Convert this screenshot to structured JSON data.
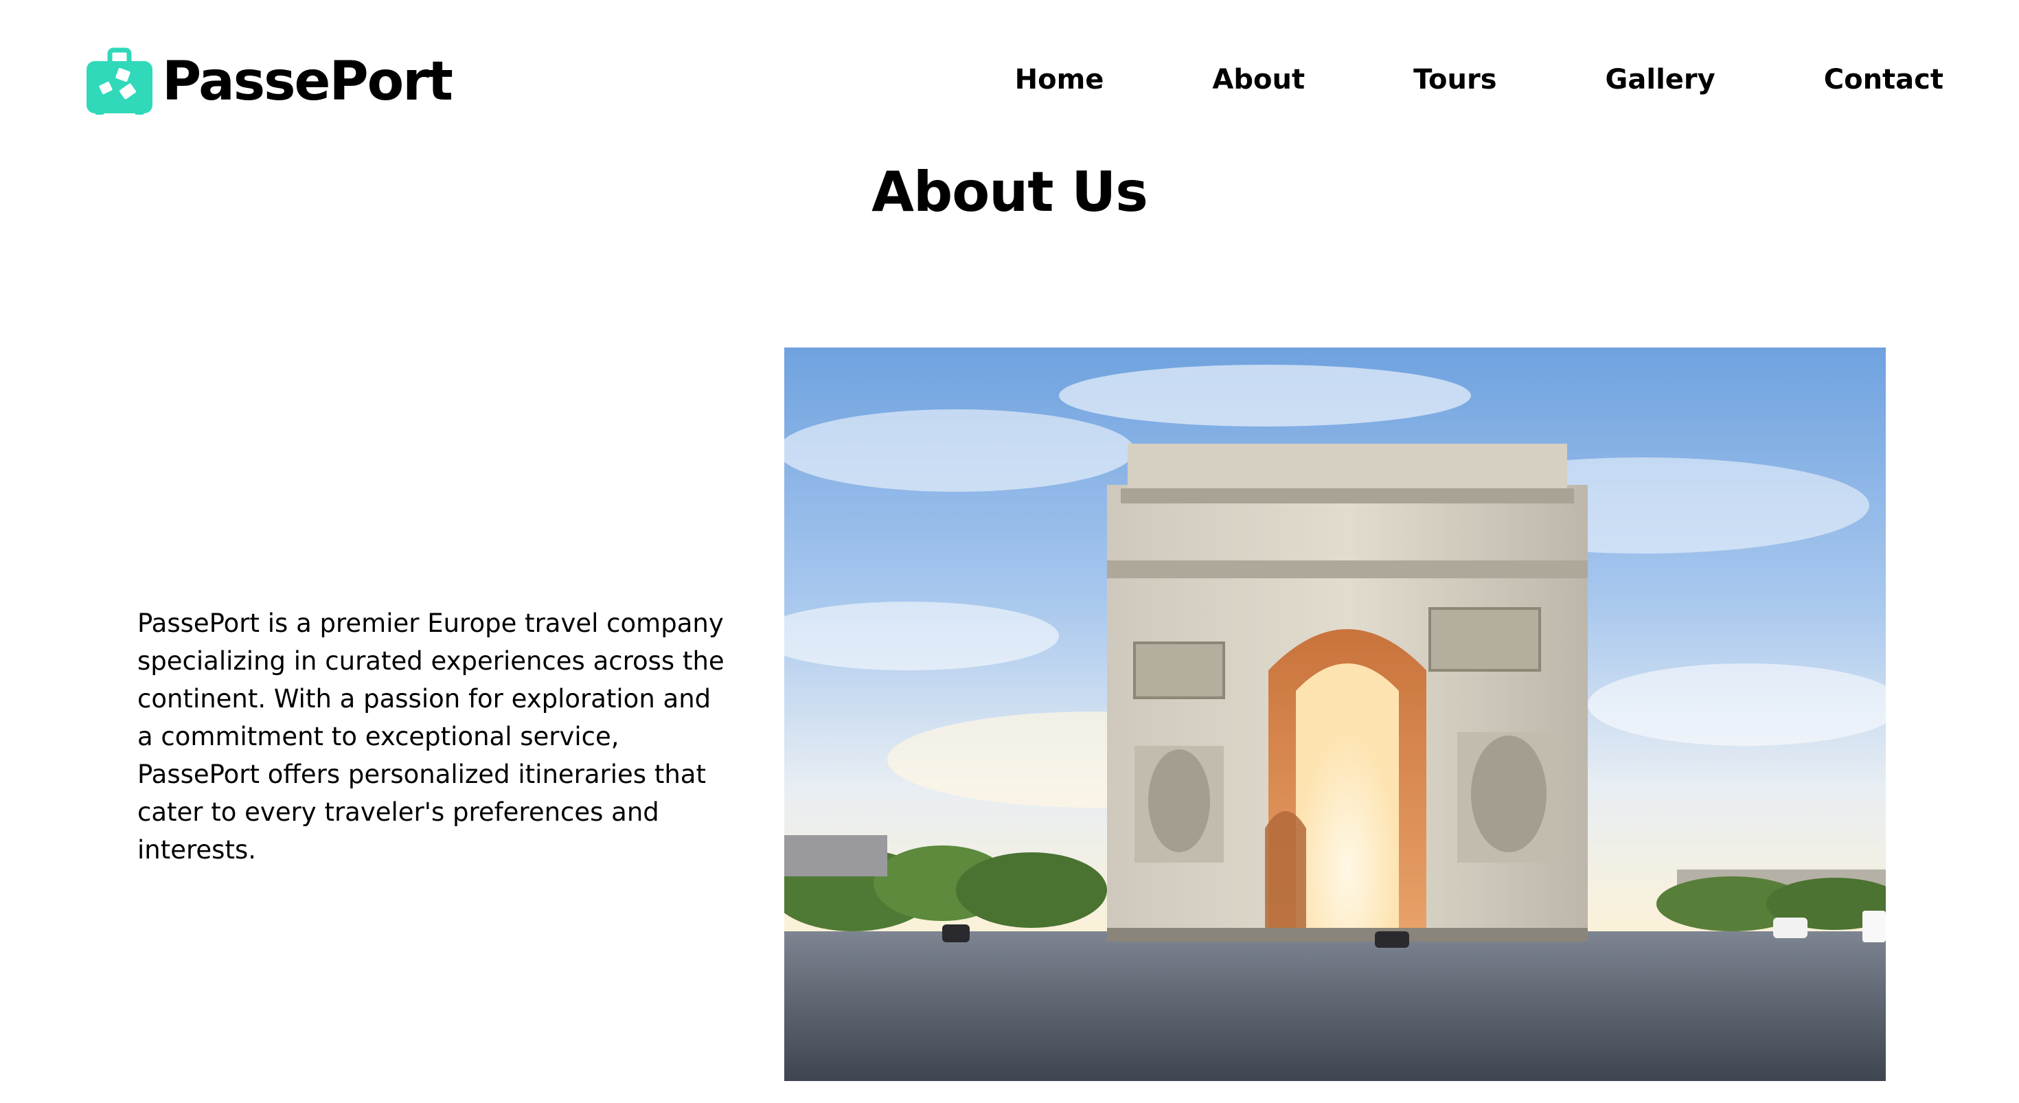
{
  "header": {
    "logo_text": "PassePort",
    "logo_icon": "suitcase-icon",
    "nav": [
      {
        "label": "Home"
      },
      {
        "label": "About"
      },
      {
        "label": "Tours"
      },
      {
        "label": "Gallery"
      },
      {
        "label": "Contact"
      }
    ]
  },
  "main": {
    "title": "About Us",
    "description": "PassePort is a premier Europe travel company specializing in curated experiences across the continent. With a passion for exploration and a commitment to exceptional service, PassePort offers personalized itineraries that cater to every traveler's preferences and interests.",
    "image_subject": "arc-de-triomphe-photo"
  },
  "colors": {
    "brand": "#2fd9b9",
    "text": "#000000",
    "background": "#ffffff"
  }
}
